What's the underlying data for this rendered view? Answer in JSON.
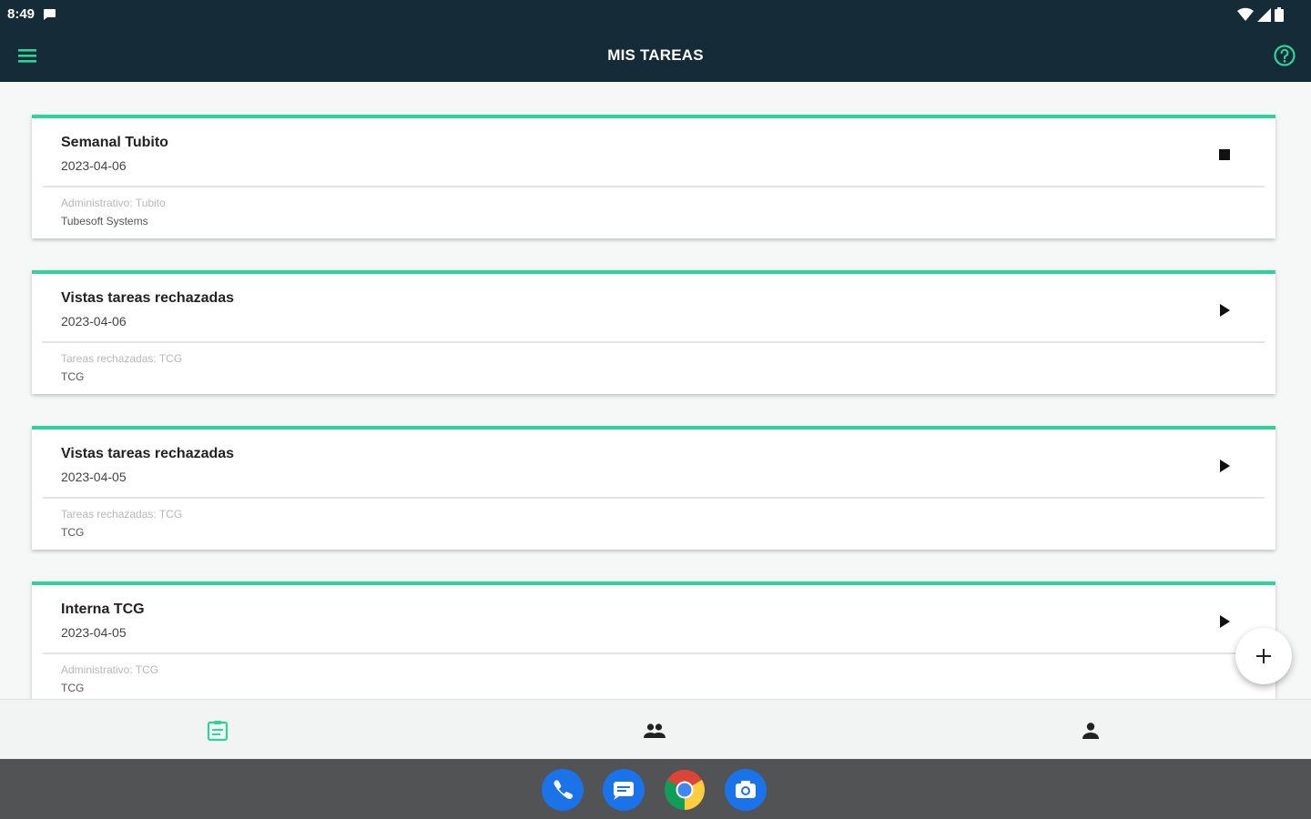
{
  "status_bar": {
    "time": "8:49",
    "icons": [
      "message-icon",
      "wifi-icon",
      "signal-icon",
      "battery-icon"
    ]
  },
  "app_bar": {
    "title": "MIS TAREAS",
    "menu_icon": "menu-icon",
    "help_icon": "help-icon"
  },
  "colors": {
    "app_bar_bg": "#152b37",
    "accent": "#2ed39a",
    "dock_bg": "#525354"
  },
  "tasks": [
    {
      "title": "Semanal Tubito",
      "date": "2023-04-06",
      "subtitle": "Administrativo: Tubito",
      "organization": "Tubesoft Systems",
      "action_icon": "stop-icon"
    },
    {
      "title": "Vistas tareas rechazadas",
      "date": "2023-04-06",
      "subtitle": "Tareas rechazadas: TCG",
      "organization": "TCG",
      "action_icon": "play-icon"
    },
    {
      "title": "Vistas tareas rechazadas",
      "date": "2023-04-05",
      "subtitle": "Tareas rechazadas: TCG",
      "organization": "TCG",
      "action_icon": "play-icon"
    },
    {
      "title": "Interna TCG",
      "date": "2023-04-05",
      "subtitle": "Administrativo: TCG",
      "organization": "TCG",
      "action_icon": "play-icon"
    }
  ],
  "fab": {
    "icon": "add-icon"
  },
  "bottom_nav": [
    {
      "icon": "tasks-icon",
      "active": true
    },
    {
      "icon": "group-icon",
      "active": false
    },
    {
      "icon": "person-icon",
      "active": false
    }
  ],
  "dock": [
    "phone-icon",
    "messages-icon",
    "chrome-icon",
    "camera-icon"
  ]
}
